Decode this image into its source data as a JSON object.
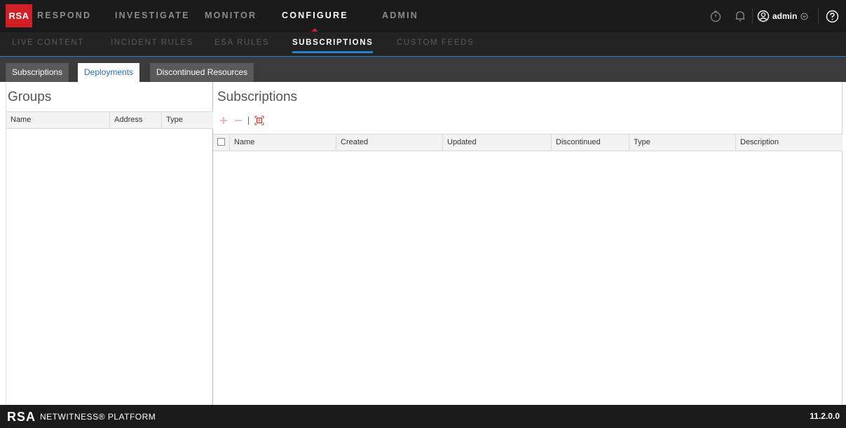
{
  "topnav": {
    "logo": "RSA",
    "items": [
      "RESPOND",
      "INVESTIGATE",
      "MONITOR",
      "CONFIGURE",
      "ADMIN"
    ],
    "active": "CONFIGURE",
    "user": "admin",
    "icons": [
      "timer-icon",
      "bell-icon",
      "user-circle-icon",
      "chevron-down-icon",
      "help-icon"
    ]
  },
  "subnav": {
    "items": [
      "LIVE CONTENT",
      "INCIDENT RULES",
      "ESA RULES",
      "SUBSCRIPTIONS",
      "CUSTOM FEEDS"
    ],
    "active": "SUBSCRIPTIONS"
  },
  "tabs": {
    "items": [
      "Subscriptions",
      "Deployments",
      "Discontinued Resources"
    ],
    "active": "Deployments"
  },
  "groups": {
    "title": "Groups",
    "columns": [
      "Name",
      "Address",
      "Type"
    ],
    "rows": []
  },
  "subscriptions": {
    "title": "Subscriptions",
    "toolbar": {
      "icons": [
        "add-icon",
        "remove-icon",
        "details-icon"
      ]
    },
    "columns": [
      "Name",
      "Created",
      "Updated",
      "Discontinued",
      "Type",
      "Description"
    ],
    "rows": []
  },
  "footer": {
    "logo_rsa": "RSA",
    "product": "NETWITNESS® PLATFORM",
    "version": "11.2.0.0"
  },
  "colors": {
    "brand_red": "#d21f26",
    "accent_blue": "#2a7ed0",
    "nav_bg": "#1b1b1b"
  }
}
